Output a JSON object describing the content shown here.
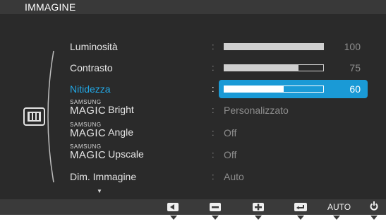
{
  "title": "IMMAGINE",
  "menu": [
    {
      "label": "Luminosità",
      "type": "slider",
      "value": 100
    },
    {
      "label": "Contrasto",
      "type": "slider",
      "value": 75
    },
    {
      "label": "Nitidezza",
      "type": "slider",
      "value": 60,
      "selected": true
    },
    {
      "brand_top": "SAMSUNG",
      "brand_main": "MAGIC",
      "label": "Bright",
      "value_text": "Personalizzato"
    },
    {
      "brand_top": "SAMSUNG",
      "brand_main": "MAGIC",
      "label": "Angle",
      "value_text": "Off"
    },
    {
      "brand_top": "SAMSUNG",
      "brand_main": "MAGIC",
      "label": "Upscale",
      "value_text": "Off"
    },
    {
      "label": "Dim. Immagine",
      "value_text": "Auto"
    }
  ],
  "colon": ":",
  "more_indicator": "▼",
  "buttons": {
    "left_icon": "left-icon",
    "minus_icon": "minus-icon",
    "plus_icon": "plus-icon",
    "enter_icon": "enter-icon",
    "auto_label": "AUTO",
    "power_icon": "power-icon"
  },
  "colors": {
    "highlight": "#1a9ad6",
    "osd_bg": "#2a2a2a",
    "selected_text": "#22a8e6"
  }
}
